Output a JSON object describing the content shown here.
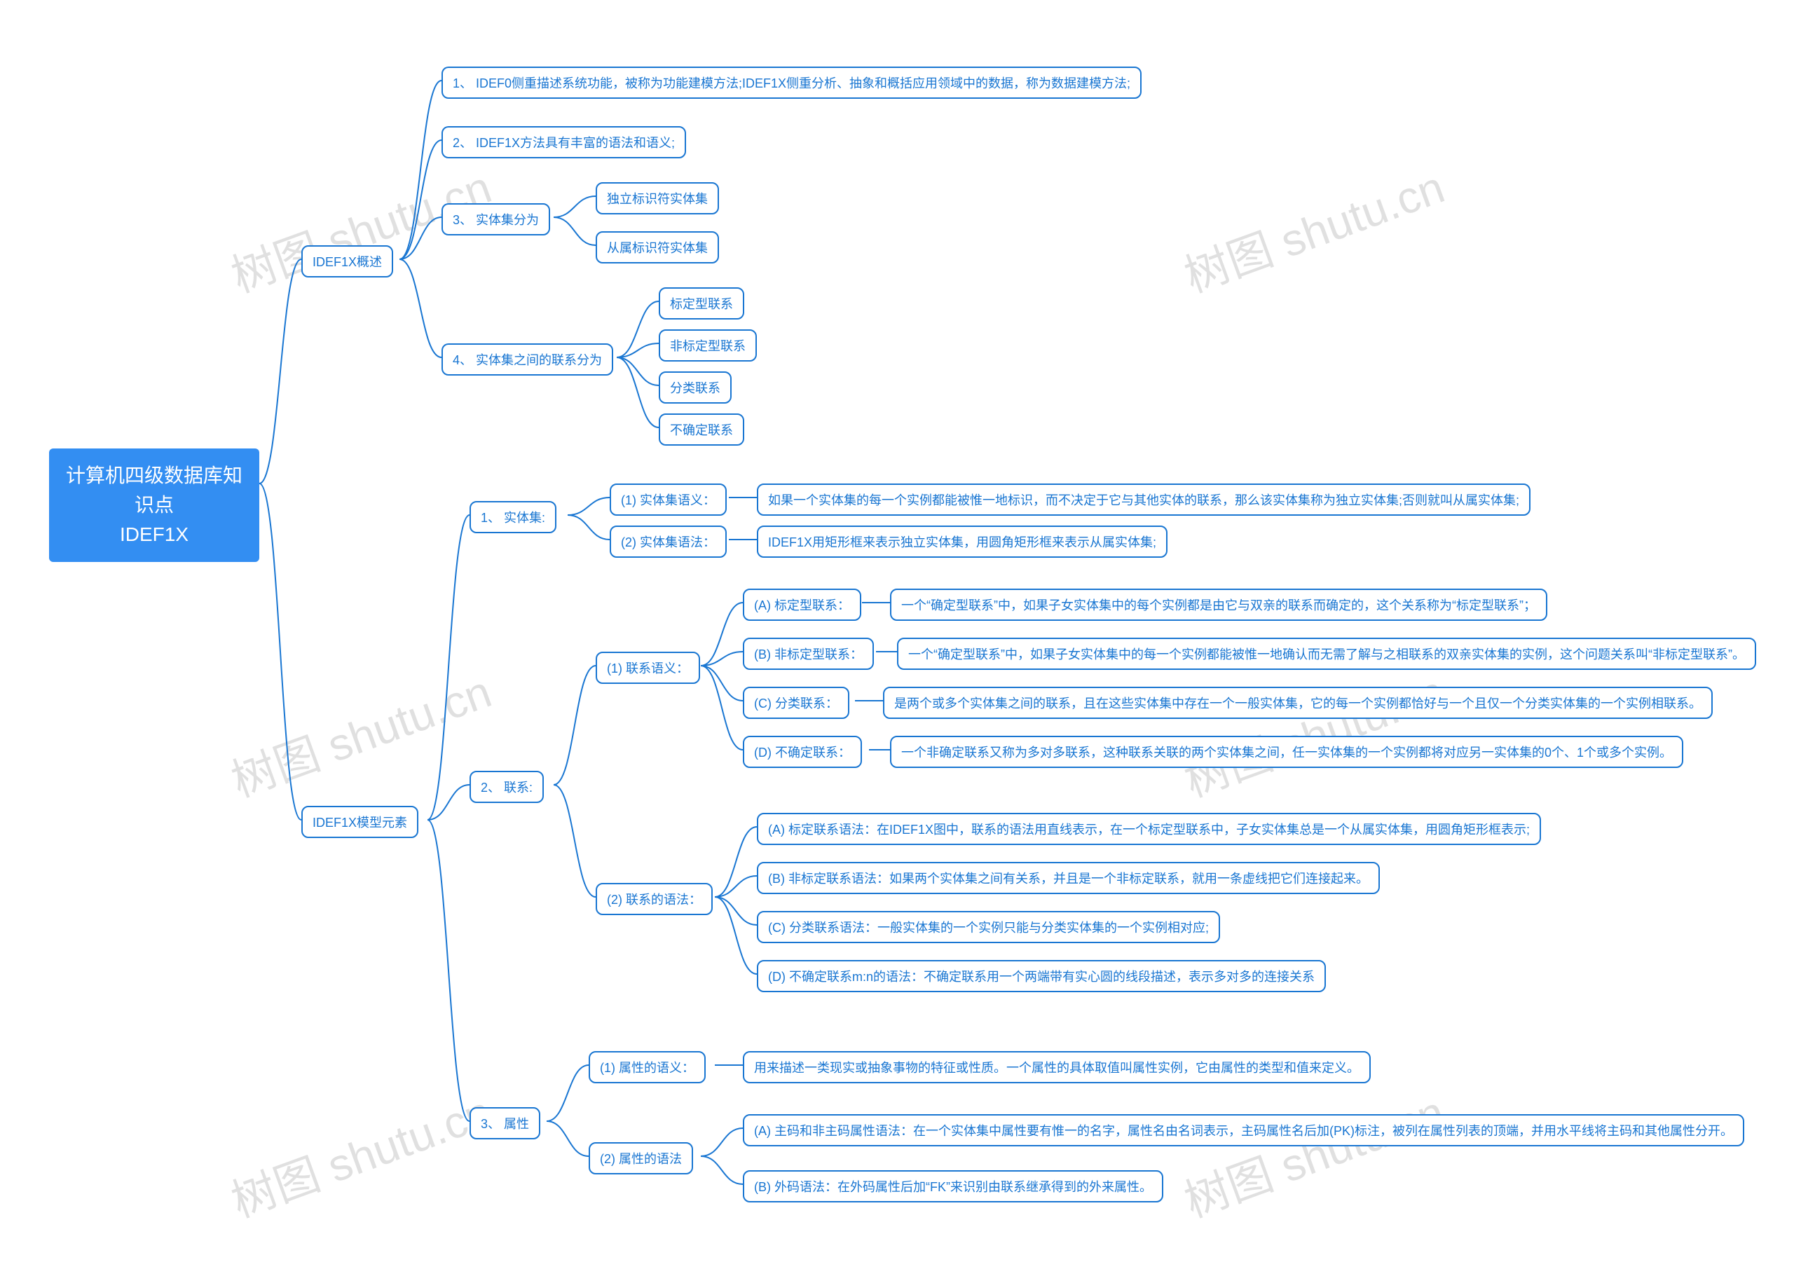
{
  "watermark_text": "树图 shutu.cn",
  "root": "计算机四级数据库知识点\nIDEF1X",
  "overview": {
    "title": "IDEF1X概述",
    "p1": "1、 IDEF0侧重描述系统功能，被称为功能建模方法;IDEF1X侧重分析、抽象和概括应用领域中的数据，称为数据建模方法;",
    "p2": "2、 IDEF1X方法具有丰富的语法和语义;",
    "p3_title": "3、 实体集分为",
    "p3_a": "独立标识符实体集",
    "p3_b": "从属标识符实体集",
    "p4_title": "4、 实体集之间的联系分为",
    "p4_a": "标定型联系",
    "p4_b": "非标定型联系",
    "p4_c": "分类联系",
    "p4_d": "不确定联系"
  },
  "model": {
    "title": "IDEF1X模型元素",
    "e1_title": "1、 实体集:",
    "e1_sem_label": "(1) 实体集语义：",
    "e1_sem_text": "如果一个实体集的每一个实例都能被惟一地标识，而不决定于它与其他实体的联系，那么该实体集称为独立实体集;否则就叫从属实体集;",
    "e1_syn_label": "(2) 实体集语法：",
    "e1_syn_text": "IDEF1X用矩形框来表示独立实体集，用圆角矩形框来表示从属实体集;",
    "e2_title": "2、 联系:",
    "e2_sem_label": "(1) 联系语义：",
    "e2_syn_label": "(2) 联系的语法：",
    "e2_sem_a_label": "(A) 标定型联系：",
    "e2_sem_a_text": "一个“确定型联系”中，如果子女实体集中的每个实例都是由它与双亲的联系而确定的，这个关系称为“标定型联系”；",
    "e2_sem_b_label": "(B) 非标定型联系：",
    "e2_sem_b_text": "一个“确定型联系”中，如果子女实体集中的每一个实例都能被惟一地确认而无需了解与之相联系的双亲实体集的实例，这个问题关系叫“非标定型联系”。",
    "e2_sem_c_label": "(C) 分类联系：",
    "e2_sem_c_text": "是两个或多个实体集之间的联系，且在这些实体集中存在一个一般实体集，它的每一个实例都恰好与一个且仅一个分类实体集的一个实例相联系。",
    "e2_sem_d_label": "(D) 不确定联系：",
    "e2_sem_d_text": "一个非确定联系又称为多对多联系，这种联系关联的两个实体集之间，任一实体集的一个实例都将对应另一实体集的0个、1个或多个实例。",
    "e2_syn_a_text": "(A) 标定联系语法：在IDEF1X图中，联系的语法用直线表示，在一个标定型联系中，子女实体集总是一个从属实体集，用圆角矩形框表示;",
    "e2_syn_b_text": "(B) 非标定联系语法：如果两个实体集之间有关系，并且是一个非标定联系，就用一条虚线把它们连接起来。",
    "e2_syn_c_text": "(C) 分类联系语法：一般实体集的一个实例只能与分类实体集的一个实例相对应;",
    "e2_syn_d_text": "(D) 不确定联系m:n的语法：不确定联系用一个两端带有实心圆的线段描述，表示多对多的连接关系",
    "e3_title": "3、 属性",
    "e3_sem_label": "(1) 属性的语义：",
    "e3_sem_text": "用来描述一类现实或抽象事物的特征或性质。一个属性的具体取值叫属性实例，它由属性的类型和值来定义。",
    "e3_syn_label": "(2) 属性的语法",
    "e3_syn_a_text": "(A) 主码和非主码属性语法：在一个实体集中属性要有惟一的名字，属性名由名词表示，主码属性名后加(PK)标注，被列在属性列表的顶端，并用水平线将主码和其他属性分开。",
    "e3_syn_b_text": "(B) 外码语法：在外码属性后加“FK”来识别由联系继承得到的外来属性。"
  },
  "chart_data": {
    "type": "tree",
    "title": "计算机四级数据库知识点 IDEF1X",
    "root": {
      "label": "计算机四级数据库知识点 IDEF1X",
      "children": [
        {
          "label": "IDEF1X概述",
          "children": [
            {
              "label": "1、 IDEF0侧重描述系统功能，被称为功能建模方法;IDEF1X侧重分析、抽象和概括应用领域中的数据，称为数据建模方法;"
            },
            {
              "label": "2、 IDEF1X方法具有丰富的语法和语义;"
            },
            {
              "label": "3、 实体集分为",
              "children": [
                {
                  "label": "独立标识符实体集"
                },
                {
                  "label": "从属标识符实体集"
                }
              ]
            },
            {
              "label": "4、 实体集之间的联系分为",
              "children": [
                {
                  "label": "标定型联系"
                },
                {
                  "label": "非标定型联系"
                },
                {
                  "label": "分类联系"
                },
                {
                  "label": "不确定联系"
                }
              ]
            }
          ]
        },
        {
          "label": "IDEF1X模型元素",
          "children": [
            {
              "label": "1、 实体集:",
              "children": [
                {
                  "label": "(1) 实体集语义：",
                  "children": [
                    {
                      "label": "如果一个实体集的每一个实例都能被惟一地标识，而不决定于它与其他实体的联系，那么该实体集称为独立实体集;否则就叫从属实体集;"
                    }
                  ]
                },
                {
                  "label": "(2) 实体集语法：",
                  "children": [
                    {
                      "label": "IDEF1X用矩形框来表示独立实体集，用圆角矩形框来表示从属实体集;"
                    }
                  ]
                }
              ]
            },
            {
              "label": "2、 联系:",
              "children": [
                {
                  "label": "(1) 联系语义：",
                  "children": [
                    {
                      "label": "(A) 标定型联系：",
                      "children": [
                        {
                          "label": "一个“确定型联系”中，如果子女实体集中的每个实例都是由它与双亲的联系而确定的，这个关系称为“标定型联系”；"
                        }
                      ]
                    },
                    {
                      "label": "(B) 非标定型联系：",
                      "children": [
                        {
                          "label": "一个“确定型联系”中，如果子女实体集中的每一个实例都能被惟一地确认而无需了解与之相联系的双亲实体集的实例，这个问题关系叫“非标定型联系”。"
                        }
                      ]
                    },
                    {
                      "label": "(C) 分类联系：",
                      "children": [
                        {
                          "label": "是两个或多个实体集之间的联系，且在这些实体集中存在一个一般实体集，它的每一个实例都恰好与一个且仅一个分类实体集的一个实例相联系。"
                        }
                      ]
                    },
                    {
                      "label": "(D) 不确定联系：",
                      "children": [
                        {
                          "label": "一个非确定联系又称为多对多联系，这种联系关联的两个实体集之间，任一实体集的一个实例都将对应另一实体集的0个、1个或多个实例。"
                        }
                      ]
                    }
                  ]
                },
                {
                  "label": "(2) 联系的语法：",
                  "children": [
                    {
                      "label": "(A) 标定联系语法：在IDEF1X图中，联系的语法用直线表示，在一个标定型联系中，子女实体集总是一个从属实体集，用圆角矩形框表示;"
                    },
                    {
                      "label": "(B) 非标定联系语法：如果两个实体集之间有关系，并且是一个非标定联系，就用一条虚线把它们连接起来。"
                    },
                    {
                      "label": "(C) 分类联系语法：一般实体集的一个实例只能与分类实体集的一个实例相对应;"
                    },
                    {
                      "label": "(D) 不确定联系m:n的语法：不确定联系用一个两端带有实心圆的线段描述，表示多对多的连接关系"
                    }
                  ]
                }
              ]
            },
            {
              "label": "3、 属性",
              "children": [
                {
                  "label": "(1) 属性的语义：",
                  "children": [
                    {
                      "label": "用来描述一类现实或抽象事物的特征或性质。一个属性的具体取值叫属性实例，它由属性的类型和值来定义。"
                    }
                  ]
                },
                {
                  "label": "(2) 属性的语法",
                  "children": [
                    {
                      "label": "(A) 主码和非主码属性语法：在一个实体集中属性要有惟一的名字，属性名由名词表示，主码属性名后加(PK)标注，被列在属性列表的顶端，并用水平线将主码和其他属性分开。"
                    },
                    {
                      "label": "(B) 外码语法：在外码属性后加“FK”来识别由联系继承得到的外来属性。"
                    }
                  ]
                }
              ]
            }
          ]
        }
      ]
    }
  }
}
